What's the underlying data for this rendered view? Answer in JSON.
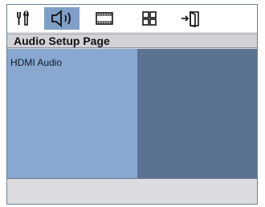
{
  "toolbar": {
    "items": [
      {
        "icon": "setup-tools-icon",
        "active": false
      },
      {
        "icon": "speaker-audio-icon",
        "active": true
      },
      {
        "icon": "video-film-icon",
        "active": false
      },
      {
        "icon": "preference-grid-icon",
        "active": false
      },
      {
        "icon": "exit-door-icon",
        "active": false
      }
    ]
  },
  "header": {
    "title": "Audio Setup Page"
  },
  "menu": {
    "items": [
      "HDMI Audio"
    ]
  },
  "colors": {
    "accent": "#7f9ec8",
    "left_panel": "#88a8cf",
    "right_panel": "#5b7292"
  }
}
